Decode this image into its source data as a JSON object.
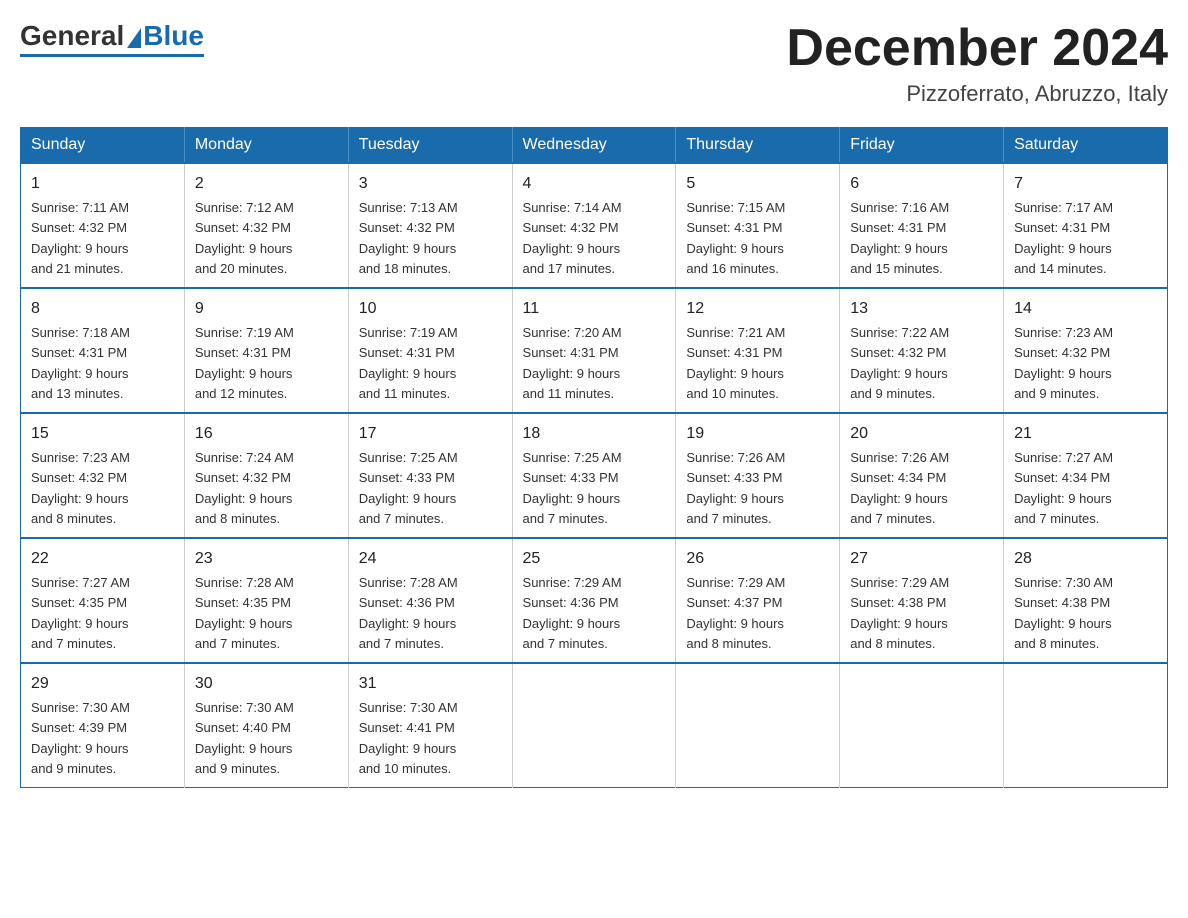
{
  "logo": {
    "general": "General",
    "blue": "Blue"
  },
  "title": "December 2024",
  "location": "Pizzoferrato, Abruzzo, Italy",
  "days_of_week": [
    "Sunday",
    "Monday",
    "Tuesday",
    "Wednesday",
    "Thursday",
    "Friday",
    "Saturday"
  ],
  "weeks": [
    [
      {
        "day": "1",
        "sunrise": "7:11 AM",
        "sunset": "4:32 PM",
        "daylight": "9 hours and 21 minutes."
      },
      {
        "day": "2",
        "sunrise": "7:12 AM",
        "sunset": "4:32 PM",
        "daylight": "9 hours and 20 minutes."
      },
      {
        "day": "3",
        "sunrise": "7:13 AM",
        "sunset": "4:32 PM",
        "daylight": "9 hours and 18 minutes."
      },
      {
        "day": "4",
        "sunrise": "7:14 AM",
        "sunset": "4:32 PM",
        "daylight": "9 hours and 17 minutes."
      },
      {
        "day": "5",
        "sunrise": "7:15 AM",
        "sunset": "4:31 PM",
        "daylight": "9 hours and 16 minutes."
      },
      {
        "day": "6",
        "sunrise": "7:16 AM",
        "sunset": "4:31 PM",
        "daylight": "9 hours and 15 minutes."
      },
      {
        "day": "7",
        "sunrise": "7:17 AM",
        "sunset": "4:31 PM",
        "daylight": "9 hours and 14 minutes."
      }
    ],
    [
      {
        "day": "8",
        "sunrise": "7:18 AM",
        "sunset": "4:31 PM",
        "daylight": "9 hours and 13 minutes."
      },
      {
        "day": "9",
        "sunrise": "7:19 AM",
        "sunset": "4:31 PM",
        "daylight": "9 hours and 12 minutes."
      },
      {
        "day": "10",
        "sunrise": "7:19 AM",
        "sunset": "4:31 PM",
        "daylight": "9 hours and 11 minutes."
      },
      {
        "day": "11",
        "sunrise": "7:20 AM",
        "sunset": "4:31 PM",
        "daylight": "9 hours and 11 minutes."
      },
      {
        "day": "12",
        "sunrise": "7:21 AM",
        "sunset": "4:31 PM",
        "daylight": "9 hours and 10 minutes."
      },
      {
        "day": "13",
        "sunrise": "7:22 AM",
        "sunset": "4:32 PM",
        "daylight": "9 hours and 9 minutes."
      },
      {
        "day": "14",
        "sunrise": "7:23 AM",
        "sunset": "4:32 PM",
        "daylight": "9 hours and 9 minutes."
      }
    ],
    [
      {
        "day": "15",
        "sunrise": "7:23 AM",
        "sunset": "4:32 PM",
        "daylight": "9 hours and 8 minutes."
      },
      {
        "day": "16",
        "sunrise": "7:24 AM",
        "sunset": "4:32 PM",
        "daylight": "9 hours and 8 minutes."
      },
      {
        "day": "17",
        "sunrise": "7:25 AM",
        "sunset": "4:33 PM",
        "daylight": "9 hours and 7 minutes."
      },
      {
        "day": "18",
        "sunrise": "7:25 AM",
        "sunset": "4:33 PM",
        "daylight": "9 hours and 7 minutes."
      },
      {
        "day": "19",
        "sunrise": "7:26 AM",
        "sunset": "4:33 PM",
        "daylight": "9 hours and 7 minutes."
      },
      {
        "day": "20",
        "sunrise": "7:26 AM",
        "sunset": "4:34 PM",
        "daylight": "9 hours and 7 minutes."
      },
      {
        "day": "21",
        "sunrise": "7:27 AM",
        "sunset": "4:34 PM",
        "daylight": "9 hours and 7 minutes."
      }
    ],
    [
      {
        "day": "22",
        "sunrise": "7:27 AM",
        "sunset": "4:35 PM",
        "daylight": "9 hours and 7 minutes."
      },
      {
        "day": "23",
        "sunrise": "7:28 AM",
        "sunset": "4:35 PM",
        "daylight": "9 hours and 7 minutes."
      },
      {
        "day": "24",
        "sunrise": "7:28 AM",
        "sunset": "4:36 PM",
        "daylight": "9 hours and 7 minutes."
      },
      {
        "day": "25",
        "sunrise": "7:29 AM",
        "sunset": "4:36 PM",
        "daylight": "9 hours and 7 minutes."
      },
      {
        "day": "26",
        "sunrise": "7:29 AM",
        "sunset": "4:37 PM",
        "daylight": "9 hours and 8 minutes."
      },
      {
        "day": "27",
        "sunrise": "7:29 AM",
        "sunset": "4:38 PM",
        "daylight": "9 hours and 8 minutes."
      },
      {
        "day": "28",
        "sunrise": "7:30 AM",
        "sunset": "4:38 PM",
        "daylight": "9 hours and 8 minutes."
      }
    ],
    [
      {
        "day": "29",
        "sunrise": "7:30 AM",
        "sunset": "4:39 PM",
        "daylight": "9 hours and 9 minutes."
      },
      {
        "day": "30",
        "sunrise": "7:30 AM",
        "sunset": "4:40 PM",
        "daylight": "9 hours and 9 minutes."
      },
      {
        "day": "31",
        "sunrise": "7:30 AM",
        "sunset": "4:41 PM",
        "daylight": "9 hours and 10 minutes."
      },
      {
        "day": "",
        "sunrise": "",
        "sunset": "",
        "daylight": ""
      },
      {
        "day": "",
        "sunrise": "",
        "sunset": "",
        "daylight": ""
      },
      {
        "day": "",
        "sunrise": "",
        "sunset": "",
        "daylight": ""
      },
      {
        "day": "",
        "sunrise": "",
        "sunset": "",
        "daylight": ""
      }
    ]
  ]
}
